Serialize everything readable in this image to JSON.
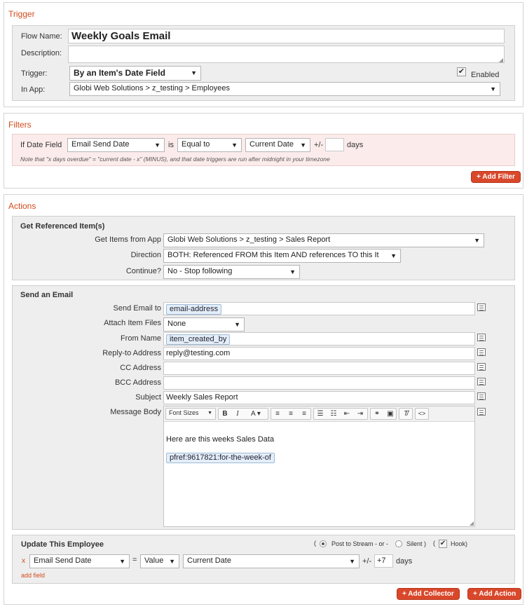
{
  "trigger": {
    "section_title": "Trigger",
    "flow_name_label": "Flow Name:",
    "flow_name_value": "Weekly Goals Email",
    "description_label": "Description:",
    "description_value": "",
    "trigger_label": "Trigger:",
    "trigger_value": "By an Item's Date Field",
    "enabled_label": "Enabled",
    "enabled_checked": "✔",
    "in_app_label": "In App:",
    "in_app_value": "Globi Web Solutions > z_testing > Employees"
  },
  "filters": {
    "section_title": "Filters",
    "if_date_field_label": "If Date Field",
    "date_field_value": "Email Send Date",
    "is_label": "is",
    "operator_value": "Equal to",
    "compare_value": "Current Date",
    "plus_minus_label": "+/-",
    "offset_value": "",
    "days_label": "days",
    "note": "Note that \"x days overdue\" = \"current date - x\" (MINUS), and that date triggers are run after midnight in your timezone",
    "add_filter_button": "+ Add Filter"
  },
  "actions": {
    "section_title": "Actions",
    "get_referenced": {
      "title": "Get Referenced Item(s)",
      "get_items_label": "Get Items from App",
      "get_items_value": "Globi Web Solutions > z_testing > Sales Report",
      "direction_label": "Direction",
      "direction_value": "BOTH: Referenced FROM this Item AND references TO this It",
      "continue_label": "Continue?",
      "continue_value": "No - Stop following"
    },
    "send_email": {
      "title": "Send an Email",
      "send_to_label": "Send Email to",
      "send_to_tag": "email-address",
      "attach_label": "Attach Item Files",
      "attach_value": "None",
      "from_name_label": "From Name",
      "from_name_tag": "item_created_by",
      "reply_to_label": "Reply-to Address",
      "reply_to_value": "reply@testing.com",
      "cc_label": "CC Address",
      "cc_value": "",
      "bcc_label": "BCC Address",
      "bcc_value": "",
      "subject_label": "Subject",
      "subject_value": "Weekly Sales Report",
      "body_label": "Message Body",
      "font_sizes_label": "Font Sizes",
      "body_text": "Here are this weeks Sales Data",
      "body_tag": "pfref:9617821:for-the-week-of"
    },
    "update_employee": {
      "title": "Update This Employee",
      "open_paren": "(",
      "post_to_stream_label": "Post to Stream - or -",
      "silent_label": "Silent )",
      "hook_open": "(",
      "hook_checked": "✔",
      "hook_label": "Hook)",
      "remove_x": "x",
      "field_value": "Email Send Date",
      "equals": "=",
      "type_value": "Value",
      "date_value": "Current Date",
      "plus_minus_label": "+/-",
      "offset_value": "+7",
      "days_label": "days",
      "add_field_link": "add field"
    },
    "add_collector_button": "+ Add Collector",
    "add_action_button": "+ Add Action"
  }
}
